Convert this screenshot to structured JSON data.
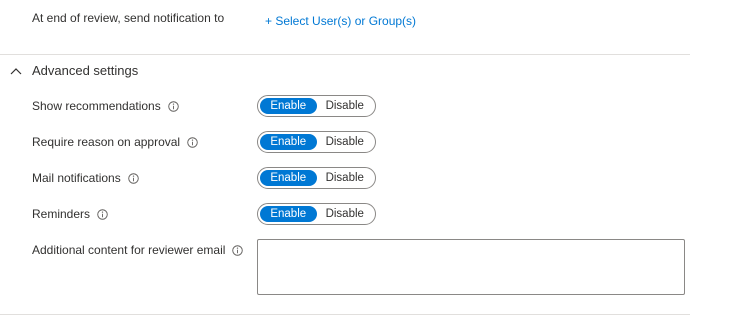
{
  "notification": {
    "label": "At end of review, send notification to",
    "select_link": "+ Select User(s) or Group(s)"
  },
  "advanced": {
    "title": "Advanced settings",
    "settings": [
      {
        "label": "Show recommendations",
        "enable": "Enable",
        "disable": "Disable",
        "selected": "Enable"
      },
      {
        "label": "Require reason on approval",
        "enable": "Enable",
        "disable": "Disable",
        "selected": "Enable"
      },
      {
        "label": "Mail notifications",
        "enable": "Enable",
        "disable": "Disable",
        "selected": "Enable"
      },
      {
        "label": "Reminders",
        "enable": "Enable",
        "disable": "Disable",
        "selected": "Enable"
      }
    ],
    "additional_content": {
      "label": "Additional content for reviewer email",
      "value": ""
    }
  },
  "icons": {
    "info": "info-icon",
    "collapse": "chevron-up-icon"
  },
  "colors": {
    "accent": "#0078d4",
    "text": "#323130",
    "border": "#8a8886",
    "divider": "#e1dfdd"
  }
}
